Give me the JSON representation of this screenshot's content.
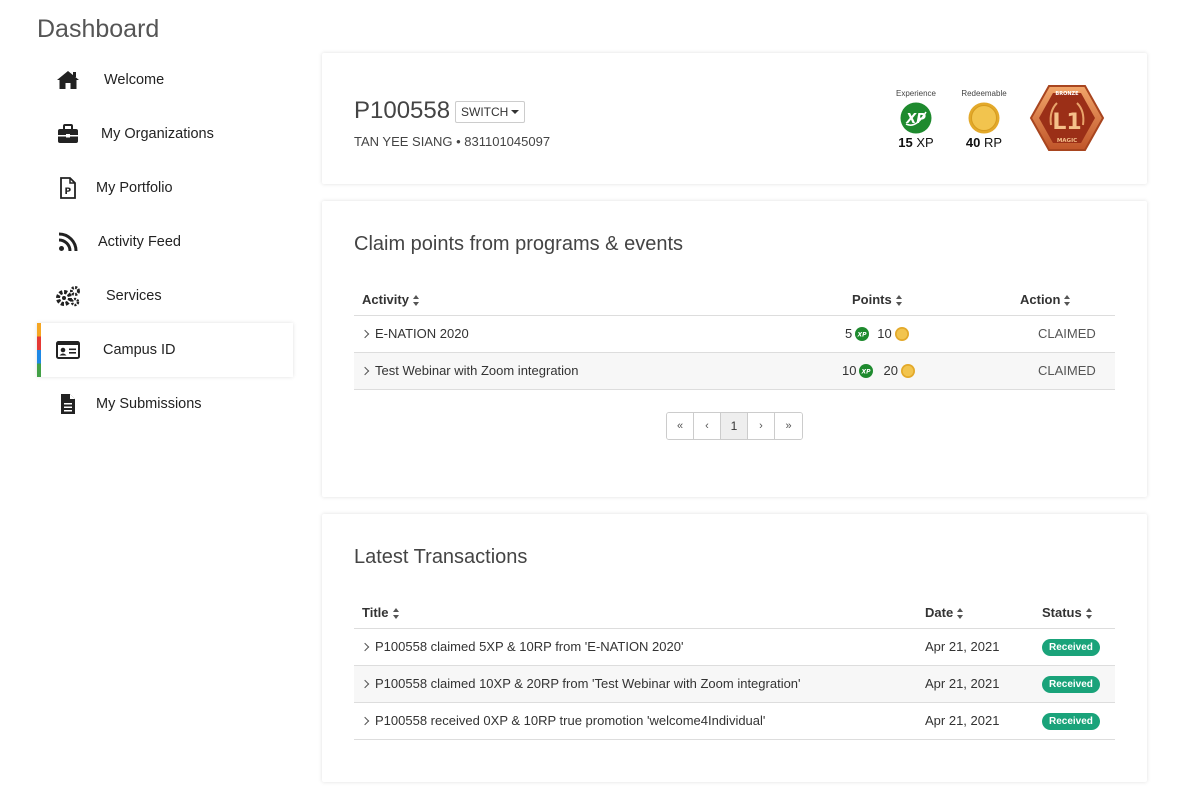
{
  "sidebar": {
    "title": "Dashboard",
    "items": [
      {
        "label": "Welcome"
      },
      {
        "label": "My Organizations"
      },
      {
        "label": "My Portfolio"
      },
      {
        "label": "Activity Feed"
      },
      {
        "label": "Services"
      },
      {
        "label": "Campus ID"
      },
      {
        "label": "My Submissions"
      }
    ]
  },
  "profile": {
    "id": "P100558",
    "switch_label": "SWITCH",
    "subline": "TAN YEE SIANG • 831101045097",
    "experience_label": "Experience",
    "experience_value": "15",
    "experience_unit": " XP",
    "redeemable_label": "Redeemable",
    "redeemable_value": "40",
    "redeemable_unit": " RP",
    "badge_level": "L1",
    "badge_top": "BRONZE",
    "badge_bottom": "MAGIC"
  },
  "claim": {
    "title": "Claim points from programs & events",
    "columns": {
      "activity": "Activity",
      "points": "Points",
      "action": "Action"
    },
    "rows": [
      {
        "activity": "E-NATION 2020",
        "xp": "5",
        "rp": "10",
        "action": "CLAIMED"
      },
      {
        "activity": "Test Webinar with Zoom integration",
        "xp": "10",
        "rp": "20",
        "action": "CLAIMED"
      }
    ],
    "pager": {
      "first": "«",
      "prev": "‹",
      "page": "1",
      "next": "›",
      "last": "»"
    }
  },
  "transactions": {
    "title": "Latest Transactions",
    "columns": {
      "title": "Title",
      "date": "Date",
      "status": "Status"
    },
    "rows": [
      {
        "title": "P100558 claimed 5XP & 10RP from 'E-NATION 2020'",
        "date": "Apr 21, 2021",
        "status": "Received"
      },
      {
        "title": "P100558 claimed 10XP & 20RP from 'Test Webinar with Zoom integration'",
        "date": "Apr 21, 2021",
        "status": "Received"
      },
      {
        "title": "P100558 received 0XP & 10RP true promotion 'welcome4Individual'",
        "date": "Apr 21, 2021",
        "status": "Received"
      }
    ]
  },
  "colors": {
    "xp": "#1e8a2e",
    "rp": "#e8b533",
    "received": "#1aa37a"
  }
}
